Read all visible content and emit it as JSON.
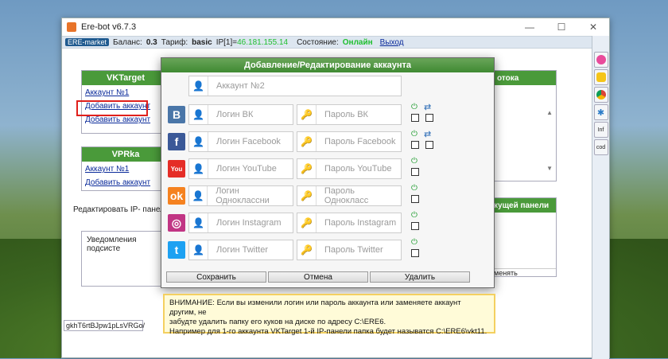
{
  "window": {
    "title": "Ere-bot v6.7.3"
  },
  "status": {
    "logo": "ERE-market",
    "balance_label": "Баланс:",
    "balance_value": "0.3",
    "tariff_label": "Тариф:",
    "tariff_value": "basic",
    "ip_label": "IP[1]=",
    "ip_value": "46.181.155.14",
    "state_label": "Состояние:",
    "state_value": "Онлайн",
    "exit_label": "Выход"
  },
  "vktarget": {
    "title": "VKTarget",
    "items": [
      "Аккаунт №1",
      "Добавить аккаунт",
      "Добавить аккаунт"
    ]
  },
  "vprka": {
    "title": "VPRka",
    "items": [
      "Аккаунт №1",
      "Добавить аккаунт"
    ]
  },
  "labels": {
    "edit_ip_panel": "Редактировать IP- панель:",
    "notifications": "Уведомления подсисте",
    "bottom_input": "gkhT6rtBJpw1pLsVRGo/"
  },
  "right_panels": {
    "top_title": "отока",
    "bottom_title": "кущей панели",
    "bottom_foot": "менять"
  },
  "side_buttons": [
    "Inf",
    "cod"
  ],
  "dialog": {
    "title": "Добавление/Редактирование аккаунта",
    "account_name": "Аккаунт №2",
    "rows": [
      {
        "network": "ВКонтакте",
        "icon": "В",
        "color": "#4a76a8",
        "login": "Логин ВК",
        "password": "Пароль ВК",
        "sync": true
      },
      {
        "network": "Facebook",
        "icon": "f",
        "color": "#3b5998",
        "login": "Логин Facebook",
        "password": "Пароль Facebook",
        "sync": true
      },
      {
        "network": "YouTube",
        "icon": "You",
        "color": "#e52d27",
        "login": "Логин YouTube",
        "password": "Пароль YouTube",
        "sync": false
      },
      {
        "network": "Одноклассники",
        "icon": "ok",
        "color": "#f58220",
        "login": "Логин Одноклассни",
        "password": "Пароль Однокласс",
        "sync": false
      },
      {
        "network": "Instagram",
        "icon": "◎",
        "color": "#c13584",
        "login": "Логин Instagram",
        "password": "Пароль Instagram",
        "sync": false
      },
      {
        "network": "Twitter",
        "icon": "t",
        "color": "#1da1f2",
        "login": "Логин Twitter",
        "password": "Пароль Twitter",
        "sync": false
      }
    ],
    "buttons": {
      "save": "Сохранить",
      "cancel": "Отмена",
      "delete": "Удалить"
    }
  },
  "warning": {
    "line1": "ВНИМАНИЕ: Если вы изменили логин или пароль аккаунта или заменяете аккаунт другим, не",
    "line2": "забудте удалить папку его куков на диске по адресу C:\\ERE6.",
    "line3": "Например для 1-го аккаунта VKTarget 1-й IP-панели папка будет называтся C:\\ERE6\\vkt11."
  }
}
